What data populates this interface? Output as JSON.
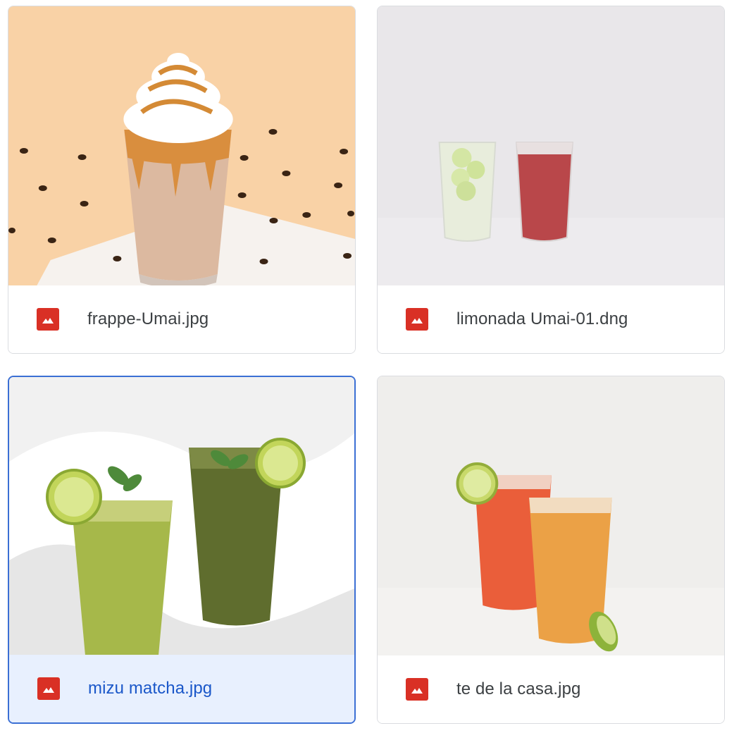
{
  "files": [
    {
      "name": "frappe-Umai.jpg",
      "icon": "image-file-icon",
      "selected": false
    },
    {
      "name": "limonada Umai-01.dng",
      "icon": "image-file-icon",
      "selected": false
    },
    {
      "name": "mizu matcha.jpg",
      "icon": "image-file-icon",
      "selected": true
    },
    {
      "name": "te de la casa.jpg",
      "icon": "image-file-icon",
      "selected": false
    }
  ],
  "colors": {
    "file_icon": "#d93025",
    "selected_border": "#3b6fd4",
    "selected_bg": "#e8f0fe",
    "selected_text": "#1a57c9",
    "text": "#3c4043",
    "card_border": "#dadce0"
  }
}
